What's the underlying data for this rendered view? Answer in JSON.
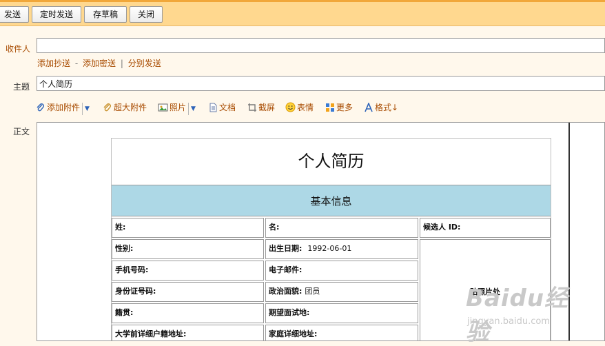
{
  "toolbar": {
    "send": "发送",
    "scheduled_send": "定时发送",
    "save_draft": "存草稿",
    "close": "关闭"
  },
  "recipient": {
    "label": "收件人",
    "value": "",
    "add_cc": "添加抄送",
    "add_bcc": "添加密送",
    "separate_send": "分别发送",
    "sep1": "-",
    "sep2": "|"
  },
  "subject": {
    "label": "主题",
    "value": "个人简历"
  },
  "attach_tools": {
    "add_attachment": "添加附件",
    "large_attachment": "超大附件",
    "photo": "照片",
    "document": "文档",
    "screenshot": "截屏",
    "emoji": "表情",
    "more": "更多",
    "format": "格式"
  },
  "body": {
    "label": "正文"
  },
  "resume": {
    "title": "个人简历",
    "section": "基本信息",
    "fields": {
      "surname": "姓:",
      "given_name": "名:",
      "candidate_id": "候选人 ID:",
      "gender": "性别:",
      "birth_date": "出生日期:",
      "birth_date_value": "1992-06-01",
      "mobile": "手机号码:",
      "email": "电子邮件:",
      "id_number": "身份证号码:",
      "political_status": "政治面貌:",
      "political_status_value": "团员",
      "native_place": "籍贯:",
      "expected_interview": "期望面试地:",
      "pre_college_address": "大学前详细户籍地址:",
      "home_address": "家庭详细地址:"
    },
    "photo_label": "贴照片处"
  },
  "watermark": {
    "brand": "Baidu经验",
    "url": "jingyan.baidu.com"
  },
  "colors": {
    "toolbar_bg": "#ffd88f",
    "toolbar_accent": "#f1a73a",
    "page_bg": "#fff8ec",
    "link": "#a84b00",
    "section_bg": "#add8e6"
  }
}
